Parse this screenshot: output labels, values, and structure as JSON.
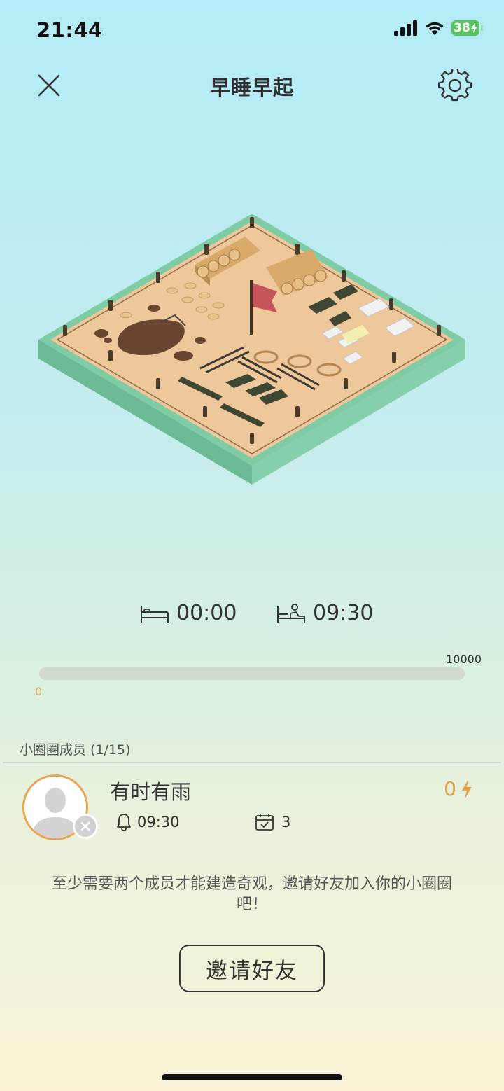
{
  "status_bar": {
    "time": "21:44",
    "battery": "38"
  },
  "nav": {
    "title": "早睡早起",
    "close_icon": "close-icon",
    "settings_icon": "gear-icon"
  },
  "schedule": {
    "bed_time": "00:00",
    "wake_time": "09:30",
    "bed_icon": "bed-icon",
    "wake_icon": "wake-up-icon"
  },
  "progress": {
    "min": "0",
    "max": "10000",
    "value": 0
  },
  "members": {
    "title": "小圈圈成员 (1/15)",
    "list": [
      {
        "name": "有时有雨",
        "alarm": "09:30",
        "checkins": "3",
        "energy": "0"
      }
    ]
  },
  "hint": "至少需要两个成员才能建造奇观，邀请好友加入你的小圈圈吧！",
  "invite_button": "邀请好友",
  "colors": {
    "accent": "#e8a450",
    "platform": "#7ecba4",
    "sand": "#eec79a"
  }
}
